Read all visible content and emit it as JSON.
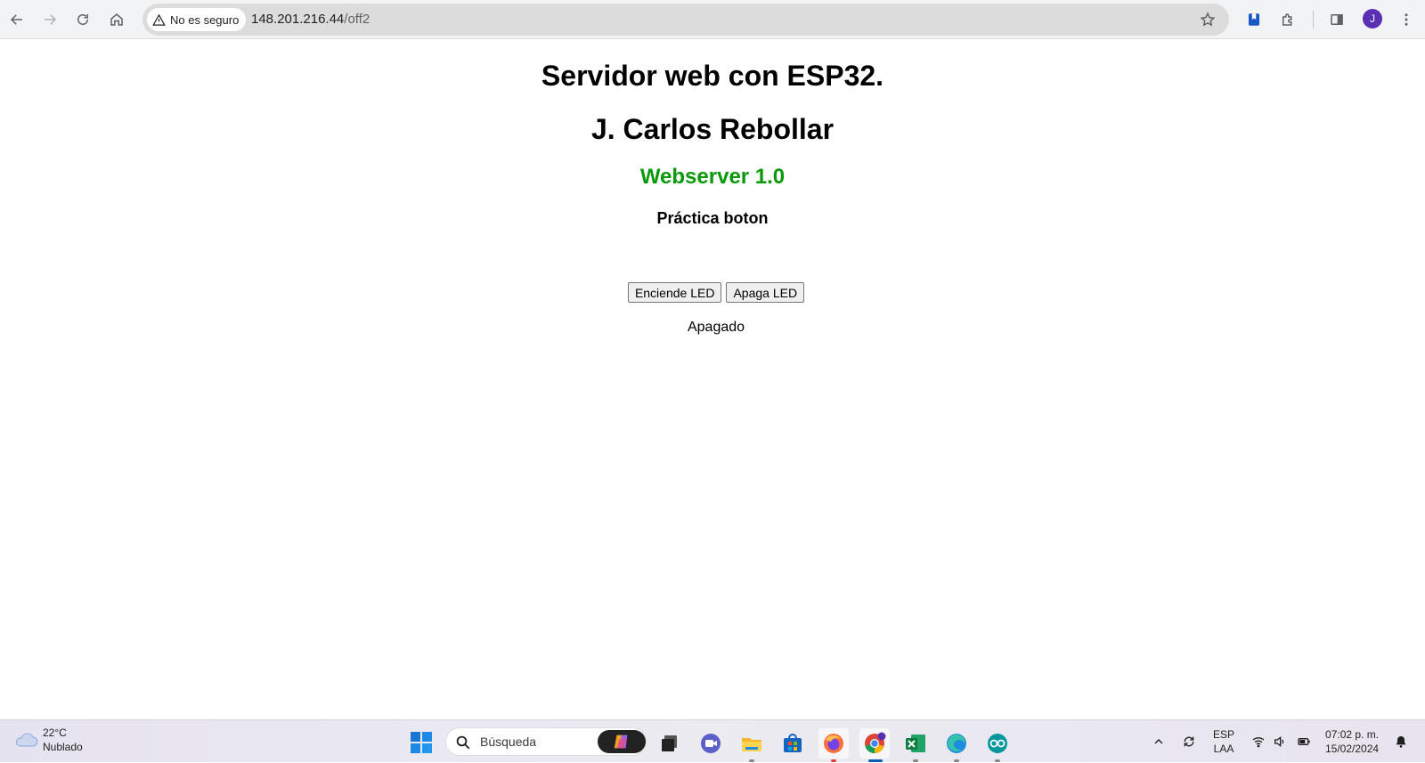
{
  "browser": {
    "security_label": "No es seguro",
    "url_host": "148.201.216.44",
    "url_path": "/off2",
    "profile_initial": "J"
  },
  "page": {
    "title": "Servidor web con ESP32.",
    "author": "J. Carlos Rebollar",
    "version": "Webserver 1.0",
    "practice": "Práctica boton",
    "buttons": {
      "on_label": "Enciende LED",
      "off_label": "Apaga LED"
    },
    "status": "Apagado",
    "colors": {
      "version_green": "#0a990a"
    }
  },
  "taskbar": {
    "weather": {
      "temp": "22°C",
      "condition": "Nublado",
      "icon": "cloud-icon"
    },
    "search_placeholder": "Búsqueda",
    "apps": [
      "copilot-icon",
      "task-view-icon",
      "teams-meet-icon",
      "file-explorer-icon",
      "store-icon",
      "firefox-icon",
      "chrome-icon",
      "excel-icon",
      "edge-icon",
      "arduino-icon"
    ],
    "chrome_badge": "J",
    "language": {
      "line1": "ESP",
      "line2": "LAA"
    },
    "time": "07:02 p. m.",
    "date": "15/02/2024"
  }
}
